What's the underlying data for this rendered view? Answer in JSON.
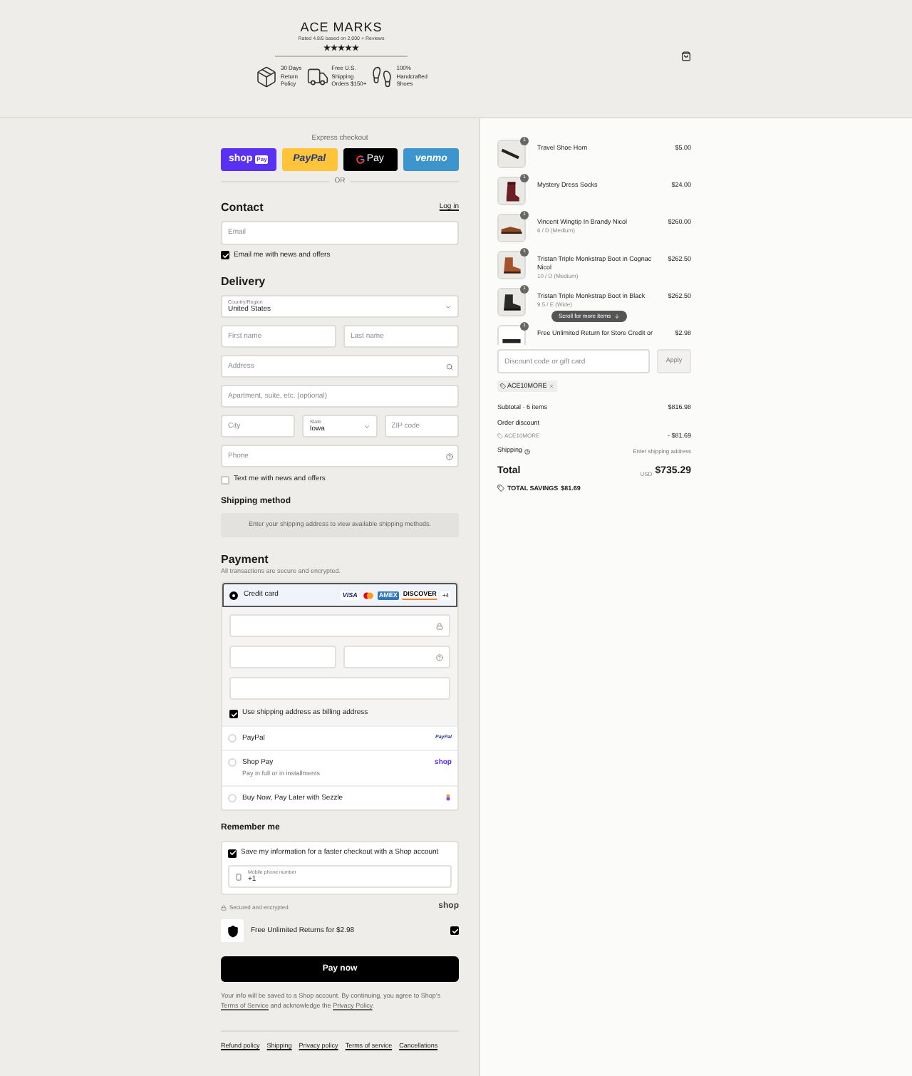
{
  "header": {
    "logo": "ACE MARKS",
    "rating": "Rated 4.8/5 based on 2,000 + Reviews",
    "stars": 5,
    "features": [
      {
        "kind": "returns",
        "lines": [
          "30 Days",
          "Return",
          "Policy"
        ]
      },
      {
        "kind": "shipping",
        "lines": [
          "Free U.S.",
          "Shipping",
          "Orders $150+"
        ]
      },
      {
        "kind": "handcrafted",
        "lines": [
          "100%",
          "Handcrafted",
          "Shoes"
        ]
      }
    ]
  },
  "express": {
    "title": "Express checkout",
    "divider": "OR",
    "buttons": [
      {
        "kind": "shop_pay",
        "label": "shop",
        "badge": "Pay"
      },
      {
        "kind": "paypal",
        "label": "PayPal"
      },
      {
        "kind": "gpay",
        "label": "Pay"
      },
      {
        "kind": "venmo",
        "label": "venmo"
      }
    ]
  },
  "contact": {
    "title": "Contact",
    "login": "Log in",
    "email": {
      "placeholder": "Email"
    },
    "news": {
      "label": "Email me with news and offers",
      "checked": true
    }
  },
  "delivery": {
    "title": "Delivery",
    "country": {
      "label": "Country/Region",
      "value": "United States"
    },
    "first_name": {
      "placeholder": "First name"
    },
    "last_name": {
      "placeholder": "Last name"
    },
    "address": {
      "placeholder": "Address"
    },
    "apartment": {
      "placeholder": "Apartment, suite, etc. (optional)"
    },
    "city": {
      "placeholder": "City"
    },
    "state": {
      "label": "State",
      "value": "Iowa"
    },
    "zip": {
      "placeholder": "ZIP code"
    },
    "phone": {
      "placeholder": "Phone"
    },
    "sms": {
      "label": "Text me with news and offers",
      "checked": false
    }
  },
  "shipping_method": {
    "title": "Shipping method",
    "notice": "Enter your shipping address to view available shipping methods."
  },
  "payment": {
    "title": "Payment",
    "subtitle": "All transactions are secure and encrypted.",
    "methods": [
      {
        "kind": "card",
        "label": "Credit card",
        "selected": true
      },
      {
        "kind": "paypal",
        "label": "PayPal",
        "logo": "PayPal",
        "selected": false
      },
      {
        "kind": "shop",
        "label": "Shop Pay",
        "sublabel": "Pay in full or in installments",
        "logo": "shop",
        "selected": false
      },
      {
        "kind": "sezzle",
        "label": "Buy Now, Pay Later with Sezzle",
        "selected": false
      }
    ],
    "card_brands": [
      {
        "kind": "visa",
        "label": "VISA"
      },
      {
        "kind": "mastercard"
      },
      {
        "kind": "amex",
        "label": "AMEX"
      },
      {
        "kind": "discover",
        "label": "DISCOVER"
      }
    ],
    "more_brands": "+4",
    "billing": {
      "label": "Use shipping address as billing address",
      "checked": true
    }
  },
  "remember": {
    "title": "Remember me",
    "save": {
      "label": "Save my information for a faster checkout with a Shop account",
      "checked": true
    },
    "mobile": {
      "label": "Mobile phone number",
      "value": "+1"
    },
    "secure": "Secured and encrypted",
    "shop_logo": "shop"
  },
  "returns": {
    "label": "Free Unlimited Returns for $2.98",
    "checked": true
  },
  "pay_button": "Pay now",
  "consent": {
    "before": "Your info will be saved to a Shop account. By continuing, you agree to Shop’s ",
    "link1": "Terms of Service",
    "middle": " and acknowledge the ",
    "link2": "Privacy Policy",
    "after": "."
  },
  "footer_links": [
    "Refund policy",
    "Shipping",
    "Privacy policy",
    "Terms of service",
    "Cancellations"
  ],
  "cart": {
    "items": [
      {
        "kind": "horn",
        "name": "Travel Shoe Horn",
        "price": "$5.00",
        "quantity": "1"
      },
      {
        "kind": "sock",
        "name": "Mystery Dress Socks",
        "price": "$24.00",
        "quantity": "1"
      },
      {
        "kind": "shoe",
        "name": "Vincent Wingtip In Brandy Nicol",
        "variant": "6 / D (Medium)",
        "price": "$260.00",
        "quantity": "1"
      },
      {
        "kind": "boot",
        "name": "Tristan Triple Monkstrap Boot in Cognac Nicol",
        "variant": "10 / D (Medium)",
        "price": "$262.50",
        "quantity": "1"
      },
      {
        "kind": "darkboot",
        "name": "Tristan Triple Monkstrap Boot in Black",
        "variant": "9.5 / E (Wide)",
        "price": "$262.50",
        "quantity": "1"
      },
      {
        "kind": "card",
        "name": "Free Unlimited Return for Store Credit or",
        "price": "$2.98",
        "quantity": "1"
      }
    ],
    "scroll_hint": "Scroll for more items",
    "discount": {
      "placeholder": "Discount code or gift card",
      "button": "Apply"
    },
    "applied_code": "ACE10MORE",
    "subtotal": {
      "label": "Subtotal · 6 items",
      "value": "$816.98"
    },
    "order_discount": {
      "label": "Order discount",
      "code": "ACE10MORE",
      "value": "- $81.69"
    },
    "shipping": {
      "label": "Shipping",
      "value": "Enter shipping address"
    },
    "total": {
      "label": "Total",
      "currency": "USD",
      "value": "$735.29"
    },
    "savings": {
      "label": "TOTAL SAVINGS",
      "value": "$81.69"
    }
  }
}
